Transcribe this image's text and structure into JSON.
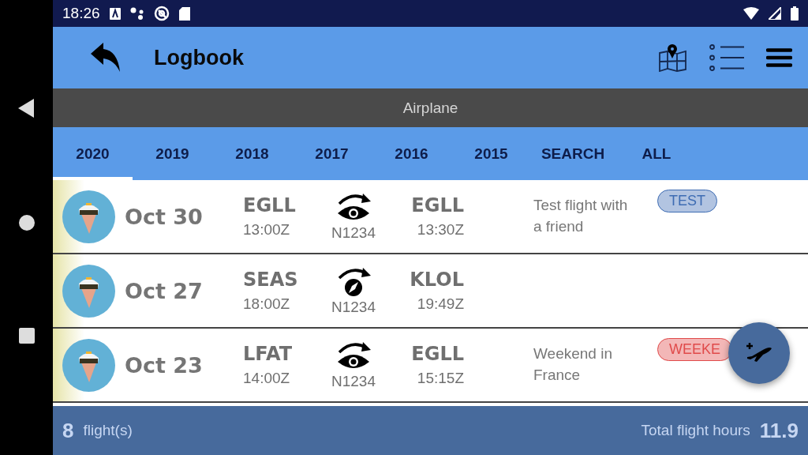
{
  "status_bar": {
    "time": "18:26"
  },
  "app_bar": {
    "title": "Logbook"
  },
  "category": "Airplane",
  "tabs": [
    {
      "label": "2020",
      "selected": true
    },
    {
      "label": "2019",
      "selected": false
    },
    {
      "label": "2018",
      "selected": false
    },
    {
      "label": "2017",
      "selected": false
    },
    {
      "label": "2016",
      "selected": false
    },
    {
      "label": "2015",
      "selected": false
    },
    {
      "label": "SEARCH",
      "selected": false
    },
    {
      "label": "ALL",
      "selected": false
    }
  ],
  "flights": [
    {
      "date": "Oct 30",
      "from": "EGLL",
      "dep_time": "13:00Z",
      "kind": "eye",
      "aircraft": "N1234",
      "to": "EGLL",
      "arr_time": "13:30Z",
      "note": "Test flight with a friend",
      "tag": {
        "label": "TEST",
        "color": "#3e6cb3"
      }
    },
    {
      "date": "Oct 27",
      "from": "SEAS",
      "dep_time": "18:00Z",
      "kind": "compass",
      "aircraft": "N1234",
      "to": "KLOL",
      "arr_time": "19:49Z"
    },
    {
      "date": "Oct 23",
      "from": "LFAT",
      "dep_time": "14:00Z",
      "kind": "eye",
      "aircraft": "N1234",
      "to": "EGLL",
      "arr_time": "15:15Z",
      "note": "Weekend in France",
      "tag": {
        "label": "WEEKE",
        "color": "#e04a4a"
      }
    }
  ],
  "footer": {
    "count": "8",
    "count_label": "flight(s)",
    "hours_label": "Total flight hours",
    "hours": "11.9"
  }
}
